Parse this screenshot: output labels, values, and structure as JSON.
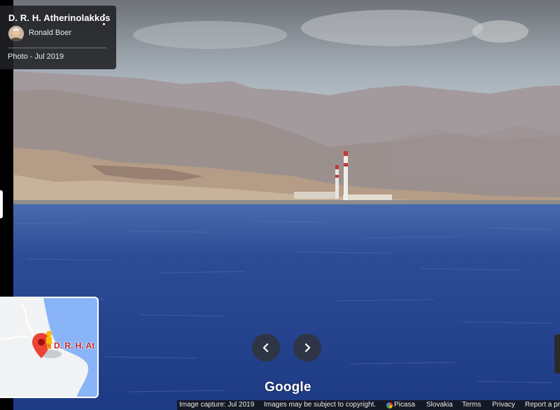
{
  "place": {
    "title": "D. R. H. Atherinolakkos"
  },
  "author": {
    "name": "Ronald Boer"
  },
  "photo": {
    "date_label": "Photo - Jul 2019"
  },
  "minimap": {
    "place_label": "D. R. H. At"
  },
  "nav": {
    "prev_icon": "chevron-left-icon",
    "next_icon": "chevron-right-icon"
  },
  "brand": {
    "logo_text": "Google"
  },
  "footer": {
    "image_capture": "Image capture: Jul 2019",
    "copyright": "Images may be subject to copyright.",
    "source": "Picasa",
    "region": "Slovakia",
    "terms": "Terms",
    "privacy": "Privacy",
    "report": "Report a problem"
  },
  "colors": {
    "sea": "#25418c",
    "card_bg": "#202124",
    "pin": "#ea4335",
    "map_water": "#8ab4f8"
  }
}
